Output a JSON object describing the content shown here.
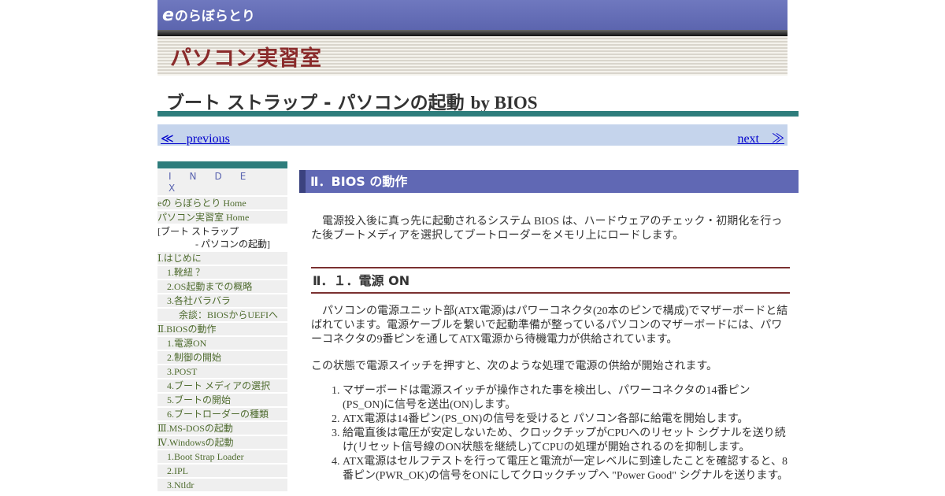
{
  "site": {
    "logo_e": "e",
    "logo_rest": "のらぼらとり",
    "title": "パソコン実習室"
  },
  "page": {
    "title_jp": "ブート ストラップ - パソコンの起動 ",
    "title_by": "by BIOS"
  },
  "nav": {
    "previous": "≪　previous",
    "next": "next　≫"
  },
  "sidebar": {
    "index_label": "INDEX",
    "items": [
      {
        "label": "eの らぼらとり Home",
        "level": 1
      },
      {
        "label": "パソコン実習室 Home",
        "level": 1
      },
      {
        "label": "[ブート ストラップ",
        "sub": "- パソコンの起動]",
        "level": 1,
        "current": true
      },
      {
        "label": "Ⅰ.はじめに",
        "level": 1
      },
      {
        "label": "1.靴紐 ？",
        "level": 2
      },
      {
        "label": "2.OS起動までの概略",
        "level": 2
      },
      {
        "label": "3.各社バラバラ",
        "level": 2
      },
      {
        "label": "余談：BIOSからUEFIへ",
        "level": 3
      },
      {
        "label": "Ⅱ.BIOSの動作",
        "level": 1
      },
      {
        "label": "1.電源ON",
        "level": 2
      },
      {
        "label": "2.制御の開始",
        "level": 2
      },
      {
        "label": "3.POST",
        "level": 2
      },
      {
        "label": "4.ブート メディアの選択",
        "level": 2
      },
      {
        "label": "5.ブートの開始",
        "level": 2
      },
      {
        "label": "6.ブートローダーの種類",
        "level": 2
      },
      {
        "label": "Ⅲ.MS-DOSの起動",
        "level": 1
      },
      {
        "label": "Ⅳ.Windowsの起動",
        "level": 1
      },
      {
        "label": "1.Boot Strap Loader",
        "level": 2
      },
      {
        "label": "2.IPL",
        "level": 2
      },
      {
        "label": "3.Ntldr",
        "level": 2
      }
    ]
  },
  "main": {
    "section_title": "Ⅱ．BIOS の動作",
    "intro": "　電源投入後に真っ先に起動されるシステム BIOS は、ハードウェアのチェック・初期化を行った後ブートメディアを選択してブートローダーをメモリ上にロードします。",
    "subsection_title": "Ⅱ．１．電源 ON",
    "para1": "　パソコンの電源ユニット部(ATX電源)はパワーコネクタ(20本のピンで構成)でマザーボードと結ばれています。電源ケーブルを繋いで起動準備が整っているパソコンのマザーボードには、パワーコネクタの9番ピンを通してATX電源から待機電力が供給されています。",
    "para2": "この状態で電源スイッチを押すと、次のような処理で電源の供給が開始されます。",
    "steps": [
      "マザーボードは電源スイッチが操作された事を検出し、パワーコネクタの14番ピン(PS_ON)に信号を送出(ON)します。",
      "ATX電源は14番ピン(PS_ON)の信号を受けると パソコン各部に給電を開始します。",
      "給電直後は電圧が安定しないため、クロックチップがCPUへのリセット シグナルを送り続け(リセット信号線のON状態を継続し)てCPUの処理が開始されるのを抑制します。",
      "ATX電源はセルフテストを行って電圧と電流が一定レベルに到達したことを確認すると、8番ピン(PWR_OK)の信号をONにしてクロックチップへ \"Power Good\" シグナルを送ります。"
    ]
  },
  "colors": {
    "banner": "#6068b4",
    "teal_rule": "#2e7d7c",
    "site_title": "#8a2b2b",
    "nav_bg": "#c5d4ec",
    "sidebar_link": "#4e6b2e",
    "sub_rule": "#7a3030"
  }
}
